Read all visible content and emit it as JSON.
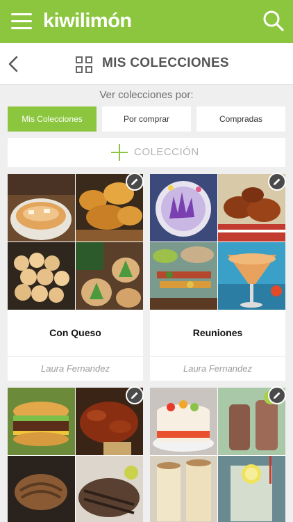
{
  "header": {
    "logo": "kiwilimón",
    "menu_icon": "hamburger-icon",
    "search_icon": "search-icon",
    "brand_color": "#8cc63f"
  },
  "titlebar": {
    "title": "MIS COLECCIONES",
    "back_icon": "chevron-left-icon",
    "grid_icon": "grid-icon"
  },
  "filter": {
    "label": "Ver colecciones por:",
    "tabs": [
      {
        "label": "Mis Colecciones",
        "active": true
      },
      {
        "label": "Por comprar",
        "active": false
      },
      {
        "label": "Compradas",
        "active": false
      }
    ]
  },
  "add_collection": {
    "label": "COLECCIÓN",
    "icon": "plus-icon"
  },
  "collections": [
    {
      "name": "Con Queso",
      "owner": "Laura Fernandez"
    },
    {
      "name": "Reuniones",
      "owner": "Laura Fernandez"
    },
    {
      "name": "",
      "owner": ""
    },
    {
      "name": "",
      "owner": ""
    }
  ]
}
